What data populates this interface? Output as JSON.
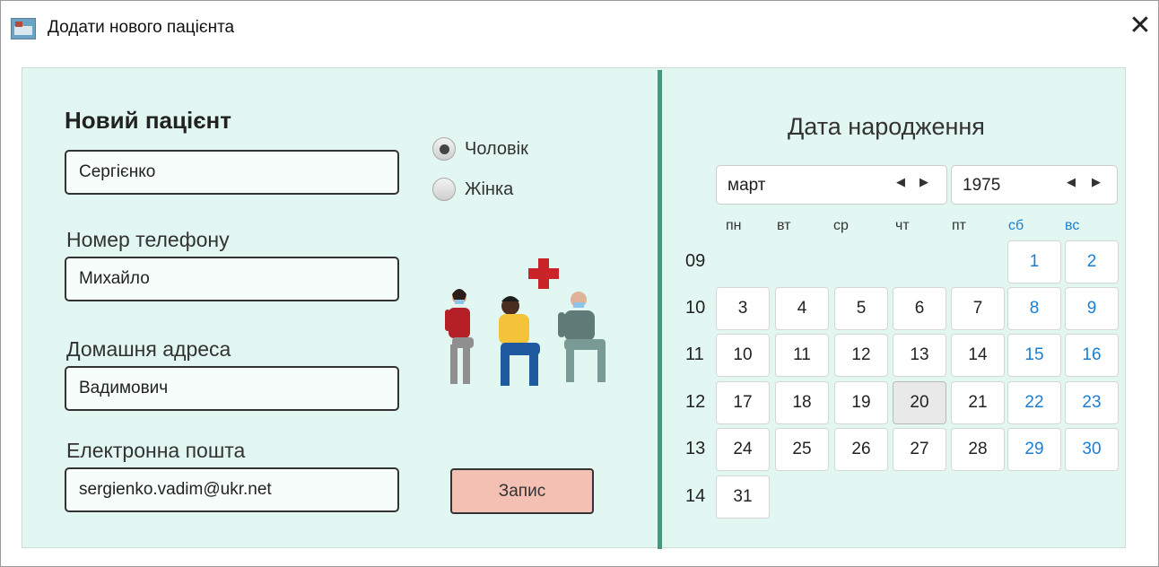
{
  "window": {
    "title": "Додати нового пацієнта",
    "close_glyph": "✕"
  },
  "form": {
    "heading": "Новий пацієнт",
    "fields": [
      {
        "label": "",
        "value": "Сергієнко"
      },
      {
        "label": "Номер телефону",
        "value": "Михайло"
      },
      {
        "label": "Домашня адреса",
        "value": "Вадимович"
      },
      {
        "label": "Електронна пошта",
        "value": "sergienko.vadim@ukr.net"
      }
    ],
    "gender": {
      "options": [
        "Чоловік",
        "Жінка"
      ],
      "selected": "Чоловік"
    },
    "save_label": "Запис",
    "illustration": "patients-waiting-illustration"
  },
  "calendar": {
    "title": "Дата народження",
    "month": "март",
    "year": "1975",
    "day_names": [
      "пн",
      "вт",
      "ср",
      "чт",
      "пт",
      "сб",
      "вс"
    ],
    "weekend_days": [
      "сб",
      "вс"
    ],
    "selected_day": "20",
    "weeks": [
      {
        "num": "09",
        "days": [
          "",
          "",
          "",
          "",
          "",
          "1",
          "2"
        ]
      },
      {
        "num": "10",
        "days": [
          "3",
          "4",
          "5",
          "6",
          "7",
          "8",
          "9"
        ]
      },
      {
        "num": "11",
        "days": [
          "10",
          "11",
          "12",
          "13",
          "14",
          "15",
          "16"
        ]
      },
      {
        "num": "12",
        "days": [
          "17",
          "18",
          "19",
          "20",
          "21",
          "22",
          "23"
        ]
      },
      {
        "num": "13",
        "days": [
          "24",
          "25",
          "26",
          "27",
          "28",
          "29",
          "30"
        ]
      },
      {
        "num": "14",
        "days": [
          "31",
          "",
          "",
          "",
          "",
          "",
          ""
        ]
      }
    ]
  },
  "colors": {
    "panel_bg": "#e2f7f1",
    "divider": "#3f9b7a",
    "save_button": "#f4c0b4",
    "weekend": "#1a7fd4",
    "cross": "#c9242a"
  }
}
